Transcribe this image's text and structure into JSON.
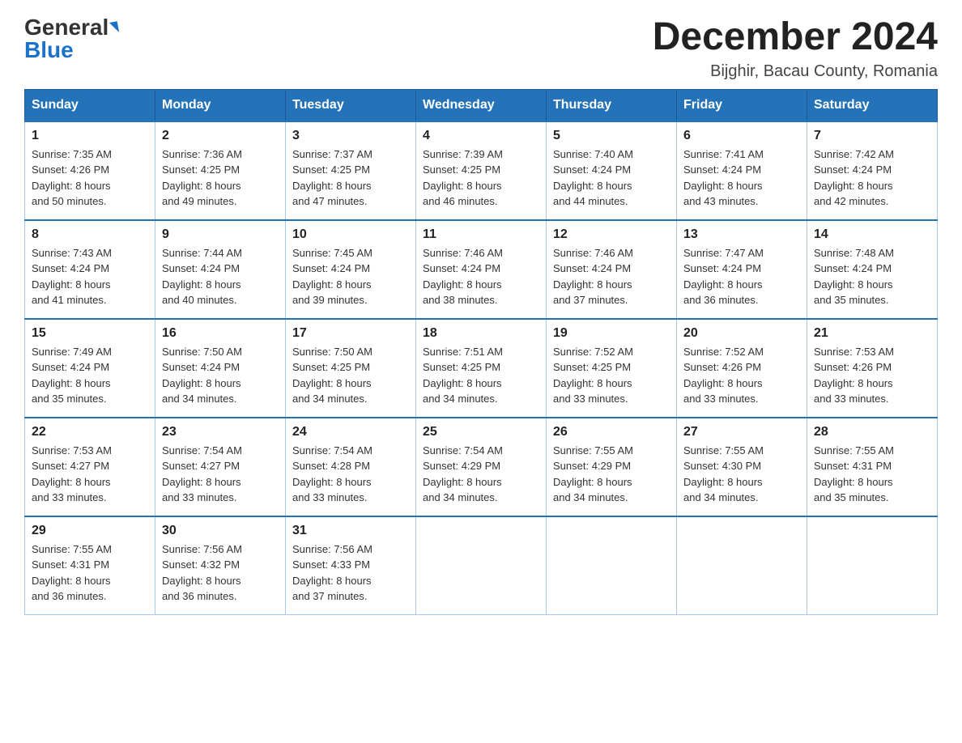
{
  "header": {
    "logo_general": "General",
    "logo_blue": "Blue",
    "month_title": "December 2024",
    "location": "Bijghir, Bacau County, Romania"
  },
  "days_of_week": [
    "Sunday",
    "Monday",
    "Tuesday",
    "Wednesday",
    "Thursday",
    "Friday",
    "Saturday"
  ],
  "weeks": [
    [
      {
        "day": "1",
        "sunrise": "7:35 AM",
        "sunset": "4:26 PM",
        "daylight": "8 hours and 50 minutes."
      },
      {
        "day": "2",
        "sunrise": "7:36 AM",
        "sunset": "4:25 PM",
        "daylight": "8 hours and 49 minutes."
      },
      {
        "day": "3",
        "sunrise": "7:37 AM",
        "sunset": "4:25 PM",
        "daylight": "8 hours and 47 minutes."
      },
      {
        "day": "4",
        "sunrise": "7:39 AM",
        "sunset": "4:25 PM",
        "daylight": "8 hours and 46 minutes."
      },
      {
        "day": "5",
        "sunrise": "7:40 AM",
        "sunset": "4:24 PM",
        "daylight": "8 hours and 44 minutes."
      },
      {
        "day": "6",
        "sunrise": "7:41 AM",
        "sunset": "4:24 PM",
        "daylight": "8 hours and 43 minutes."
      },
      {
        "day": "7",
        "sunrise": "7:42 AM",
        "sunset": "4:24 PM",
        "daylight": "8 hours and 42 minutes."
      }
    ],
    [
      {
        "day": "8",
        "sunrise": "7:43 AM",
        "sunset": "4:24 PM",
        "daylight": "8 hours and 41 minutes."
      },
      {
        "day": "9",
        "sunrise": "7:44 AM",
        "sunset": "4:24 PM",
        "daylight": "8 hours and 40 minutes."
      },
      {
        "day": "10",
        "sunrise": "7:45 AM",
        "sunset": "4:24 PM",
        "daylight": "8 hours and 39 minutes."
      },
      {
        "day": "11",
        "sunrise": "7:46 AM",
        "sunset": "4:24 PM",
        "daylight": "8 hours and 38 minutes."
      },
      {
        "day": "12",
        "sunrise": "7:46 AM",
        "sunset": "4:24 PM",
        "daylight": "8 hours and 37 minutes."
      },
      {
        "day": "13",
        "sunrise": "7:47 AM",
        "sunset": "4:24 PM",
        "daylight": "8 hours and 36 minutes."
      },
      {
        "day": "14",
        "sunrise": "7:48 AM",
        "sunset": "4:24 PM",
        "daylight": "8 hours and 35 minutes."
      }
    ],
    [
      {
        "day": "15",
        "sunrise": "7:49 AM",
        "sunset": "4:24 PM",
        "daylight": "8 hours and 35 minutes."
      },
      {
        "day": "16",
        "sunrise": "7:50 AM",
        "sunset": "4:24 PM",
        "daylight": "8 hours and 34 minutes."
      },
      {
        "day": "17",
        "sunrise": "7:50 AM",
        "sunset": "4:25 PM",
        "daylight": "8 hours and 34 minutes."
      },
      {
        "day": "18",
        "sunrise": "7:51 AM",
        "sunset": "4:25 PM",
        "daylight": "8 hours and 34 minutes."
      },
      {
        "day": "19",
        "sunrise": "7:52 AM",
        "sunset": "4:25 PM",
        "daylight": "8 hours and 33 minutes."
      },
      {
        "day": "20",
        "sunrise": "7:52 AM",
        "sunset": "4:26 PM",
        "daylight": "8 hours and 33 minutes."
      },
      {
        "day": "21",
        "sunrise": "7:53 AM",
        "sunset": "4:26 PM",
        "daylight": "8 hours and 33 minutes."
      }
    ],
    [
      {
        "day": "22",
        "sunrise": "7:53 AM",
        "sunset": "4:27 PM",
        "daylight": "8 hours and 33 minutes."
      },
      {
        "day": "23",
        "sunrise": "7:54 AM",
        "sunset": "4:27 PM",
        "daylight": "8 hours and 33 minutes."
      },
      {
        "day": "24",
        "sunrise": "7:54 AM",
        "sunset": "4:28 PM",
        "daylight": "8 hours and 33 minutes."
      },
      {
        "day": "25",
        "sunrise": "7:54 AM",
        "sunset": "4:29 PM",
        "daylight": "8 hours and 34 minutes."
      },
      {
        "day": "26",
        "sunrise": "7:55 AM",
        "sunset": "4:29 PM",
        "daylight": "8 hours and 34 minutes."
      },
      {
        "day": "27",
        "sunrise": "7:55 AM",
        "sunset": "4:30 PM",
        "daylight": "8 hours and 34 minutes."
      },
      {
        "day": "28",
        "sunrise": "7:55 AM",
        "sunset": "4:31 PM",
        "daylight": "8 hours and 35 minutes."
      }
    ],
    [
      {
        "day": "29",
        "sunrise": "7:55 AM",
        "sunset": "4:31 PM",
        "daylight": "8 hours and 36 minutes."
      },
      {
        "day": "30",
        "sunrise": "7:56 AM",
        "sunset": "4:32 PM",
        "daylight": "8 hours and 36 minutes."
      },
      {
        "day": "31",
        "sunrise": "7:56 AM",
        "sunset": "4:33 PM",
        "daylight": "8 hours and 37 minutes."
      },
      null,
      null,
      null,
      null
    ]
  ],
  "labels": {
    "sunrise": "Sunrise:",
    "sunset": "Sunset:",
    "daylight": "Daylight:"
  }
}
